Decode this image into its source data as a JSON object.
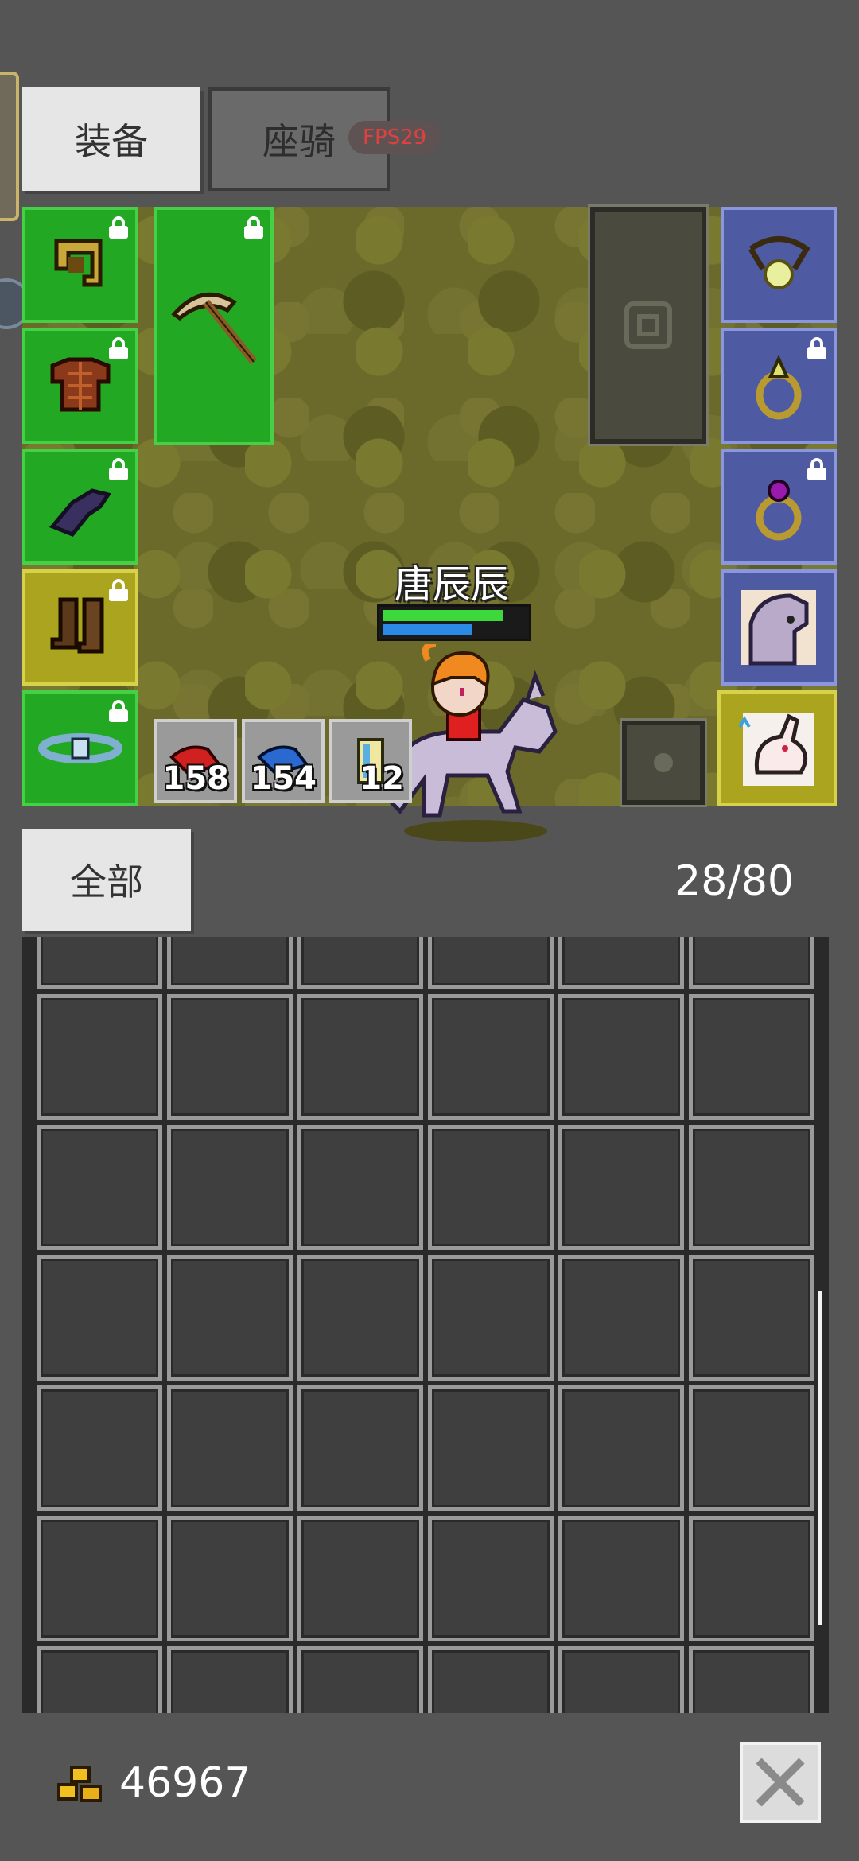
{
  "tabs": [
    {
      "label": "装备",
      "active": true
    },
    {
      "label": "座骑",
      "active": false
    }
  ],
  "fps_badge": "FPS29",
  "character": {
    "name": "唐辰辰",
    "hp_fraction": 0.86,
    "mp_fraction": 0.64
  },
  "equipment_left": [
    {
      "icon": "helmet-icon",
      "rarity": "green",
      "locked": true
    },
    {
      "icon": "armor-icon",
      "rarity": "green",
      "locked": true
    },
    {
      "icon": "gloves-icon",
      "rarity": "green",
      "locked": true
    },
    {
      "icon": "boots-icon",
      "rarity": "yellow",
      "locked": true
    },
    {
      "icon": "belt-icon",
      "rarity": "green",
      "locked": true
    }
  ],
  "weapon": {
    "icon": "pickaxe-icon",
    "rarity": "green",
    "locked": true
  },
  "equipment_right": [
    {
      "icon": "necklace-icon",
      "rarity": "blue",
      "locked": false
    },
    {
      "icon": "ring-yellow-gem-icon",
      "rarity": "blue",
      "locked": true
    },
    {
      "icon": "ring-purple-gem-icon",
      "rarity": "blue",
      "locked": true
    },
    {
      "icon": "horse-mount-icon",
      "rarity": "blue",
      "locked": false
    },
    {
      "icon": "rabbit-pet-icon",
      "rarity": "yellow",
      "locked": false
    }
  ],
  "consumables": [
    {
      "icon": "red-potion-icon",
      "count": "158"
    },
    {
      "icon": "blue-potion-icon",
      "count": "154"
    },
    {
      "icon": "scroll-icon",
      "count": "12"
    }
  ],
  "bag": {
    "filter_label": "全部",
    "capacity": "28/80"
  },
  "gold": "46967",
  "colors": {
    "slot_green": "#23a823",
    "slot_yellow": "#aaa41e",
    "slot_blue": "#4e5aa2",
    "hp": "#3cd83c",
    "mp": "#2a8ae6"
  }
}
